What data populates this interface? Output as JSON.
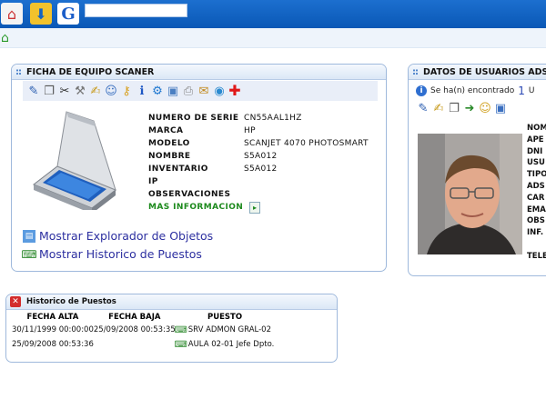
{
  "topbar": {
    "icons": [
      "home-icon",
      "download-icon",
      "google-icon"
    ],
    "google_letter": "G",
    "search_value": ""
  },
  "subbar": {
    "icon": "home-icon"
  },
  "equipo_panel": {
    "title": "FICHA DE EQUIPO SCANER",
    "toolbar_icons": [
      "edit-icon",
      "copy-icon",
      "cut-icon",
      "tools-icon",
      "note-icon",
      "users-icon",
      "wrench-icon",
      "info-icon",
      "settings-icon",
      "monitor-icon",
      "print-icon",
      "email-icon",
      "globe-icon",
      "add-icon"
    ],
    "fields": [
      {
        "label": "NUMERO DE SERIE",
        "value": "CN55AAL1HZ"
      },
      {
        "label": "MARCA",
        "value": "HP"
      },
      {
        "label": "MODELO",
        "value": "SCANJET 4070 PHOTOSMART"
      },
      {
        "label": "NOMBRE",
        "value": "S5A012"
      },
      {
        "label": "INVENTARIO",
        "value": "S5A012"
      },
      {
        "label": "IP",
        "value": ""
      },
      {
        "label": "OBSERVACIONES",
        "value": ""
      },
      {
        "label": "MAS INFORMACION",
        "value": ""
      }
    ],
    "links": [
      {
        "label": "Mostrar Explorador de Objetos",
        "icon": "explorer-icon"
      },
      {
        "label": "Mostrar Historico de Puestos",
        "icon": "workstation-icon"
      }
    ]
  },
  "usuarios_panel": {
    "title": "DATOS DE USUARIOS ADS",
    "found_text": "Se ha(n) encontrado",
    "found_count": "1",
    "found_suffix": "U",
    "toolbar_icons": [
      "edit-icon",
      "note-icon",
      "copy-icon",
      "forward-icon",
      "users-icon",
      "computer-icon"
    ],
    "labels": [
      "NOM",
      "APE",
      "DNI",
      "USU",
      "TIPO",
      "ADS",
      "CAR",
      "EMA",
      "OBS",
      "INF.",
      "",
      "TELE"
    ]
  },
  "historico_panel": {
    "title": "Historico de Puestos",
    "columns": [
      "FECHA ALTA",
      "FECHA BAJA",
      "PUESTO"
    ],
    "rows": [
      {
        "alta": "30/11/1999 00:00:00",
        "baja": "25/09/2008 00:53:35",
        "puesto": "SRV ADMON GRAL-02"
      },
      {
        "alta": "25/09/2008 00:53:36",
        "baja": "",
        "puesto": "AULA 02-01 Jefe Dpto."
      }
    ]
  }
}
